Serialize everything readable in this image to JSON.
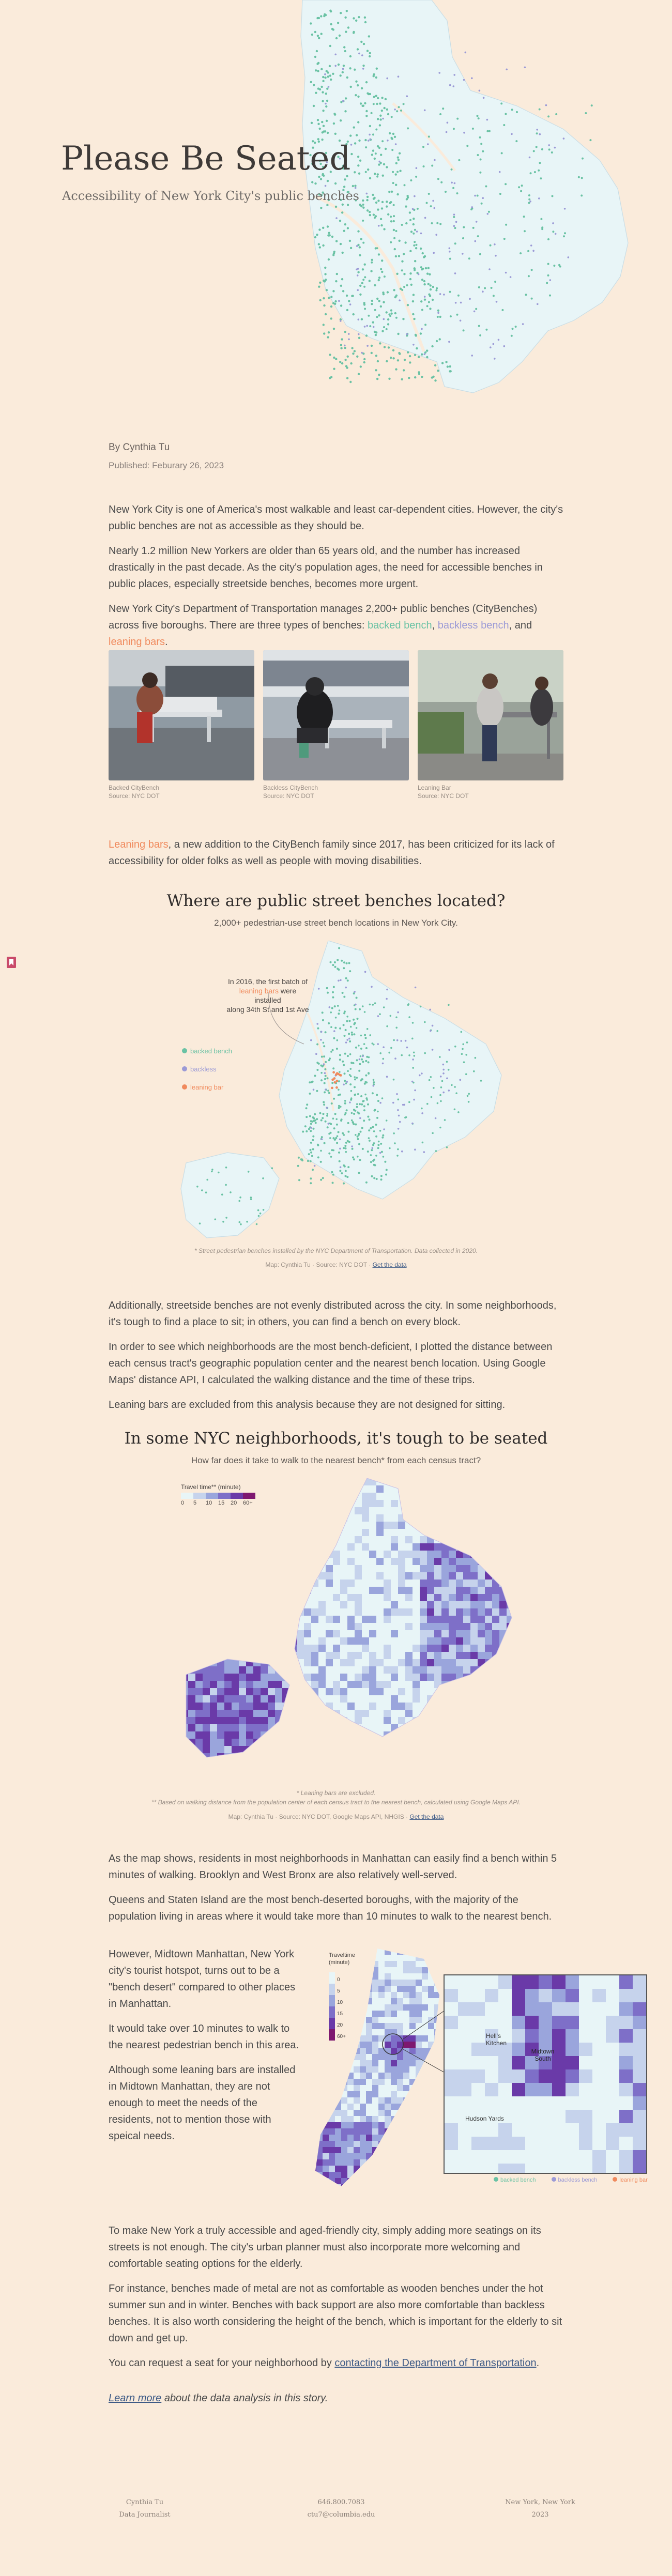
{
  "hero": {
    "title": "Please Be Seated",
    "subtitle": "Accessibility of New York City's public benches"
  },
  "byline": {
    "author": "By Cynthia Tu",
    "published": "Published: Feburary 26, 2023"
  },
  "intro": {
    "p1": "New York City is one of America's most walkable and least car-dependent cities. However, the city's public benches are not as accessible as they should be.",
    "p2": "Nearly 1.2 million New Yorkers are older than 65 years old, and the number has increased drastically in the past decade. As the city's population ages, the need for accessible benches in public places, especially streetside benches, becomes more urgent.",
    "p3_start": "New York City's Department of Transportation manages 2,200+ public benches (CityBenches) across five boroughs. There are three types of benches: ",
    "backed": "backed bench",
    "sep1": ", ",
    "backless": "backless bench",
    "sep2": ", and ",
    "leaning": "leaning bars",
    "end": "."
  },
  "photos": [
    {
      "caption1": "Backed CityBench",
      "caption2": "Source: NYC DOT"
    },
    {
      "caption1": "Backless CityBench",
      "caption2": "Source: NYC DOT"
    },
    {
      "caption1": "Leaning Bar",
      "caption2": "Source: NYC DOT"
    }
  ],
  "leaning_para": {
    "highlight": "Leaning bars",
    "rest": ", a new addition to the CityBench family since 2017, has been criticized for its lack of accessibility for older folks as well as people with moving disabilities."
  },
  "bookmark_icon": "bookmark-icon",
  "section1": {
    "title": "Where are public street benches located?",
    "subtitle": "2,000+ pedestrian-use street bench locations in New York City.",
    "annotation_a": "In 2016, the first batch of",
    "annotation_b_highlight": "leaning bars",
    "annotation_b_rest": " were installed",
    "annotation_c": "along 34th St and 1st Ave",
    "legend": [
      "backed bench",
      "backless",
      "leaning bar"
    ],
    "note": "* Street pedestrian benches installed by the NYC Department of Transportation. Data collected in 2020.",
    "credit": "Map: Cynthia Tu · Source: NYC DOT · ",
    "credit_link": "Get the data"
  },
  "section1_text": {
    "p1": "Additionally, streetside benches are not evenly distributed across the city. In some neighborhoods, it's tough to find a place to sit; in others, you can find a bench on every block.",
    "p2": "In order to see which neighborhoods are the most bench-deficient, I plotted the distance between each census tract's geographic population center and the nearest bench location. Using Google Maps' distance API, I calculated the walking distance and the time of these trips.",
    "p3": "Leaning bars are excluded from this analysis because they are not designed for sitting."
  },
  "section2": {
    "title": "In some NYC neighborhoods, it's tough to be seated",
    "subtitle": "How far does it take to walk to the nearest bench* from each census tract?",
    "legend_title": "Travel time** (minute)",
    "legend_ticks": [
      "0",
      "5",
      "10",
      "15",
      "20",
      "60+"
    ],
    "note1": "* Leaning bars are excluded.",
    "note2": "** Based on walking distance from the population center of each census tract to the nearest bench, calculated using Google Maps API.",
    "credit": "Map: Cynthia Tu · Source: NYC DOT, Google Maps API, NHGIS · ",
    "credit_link": "Get the data"
  },
  "section2_text": {
    "p1": "As the map shows, residents in most neighborhoods in Manhattan can easily find a bench within 5 minutes of walking. Brooklyn and West Bronx are also relatively well-served.",
    "p2": "Queens and Staten Island are the most bench-deserted boroughs, with the majority of the population living in areas where it would take more than 10 minutes to walk to the nearest bench."
  },
  "midtown": {
    "p1": "However, Midtown Manhattan, New York city's tourist hotspot, turns out to be a \"bench desert\" compared to other places in Manhattan.",
    "p2": "It would take over 10 minutes to walk to the nearest pedestrian bench in this area.",
    "p3": "Although some leaning bars are installed in Midtown Manhattan, they are not enough to meet the needs of the residents, not to mention those with speical needs.",
    "legend_title": "Traveltime (minute)",
    "legend_ticks": [
      "0",
      "5",
      "10",
      "15",
      "20",
      "60+"
    ],
    "inset_labels": [
      "Hell's Kitchen",
      "Midtown South",
      "Hudson Yards"
    ],
    "legend": [
      "backed bench",
      "backless bench",
      "leaning bar"
    ]
  },
  "closing": {
    "p1": "To make New York a truly accessible and aged-friendly city, simply adding more seatings on its streets is not enough. The city's urban planner must also incorporate more welcoming and comfortable seating options for the elderly.",
    "p2": "For instance, benches made of metal are not as comfortable as wooden benches under the hot summer sun and in winter. Benches with back support are also more comfortable than backless benches. It is also worth considering the height of the bench, which is important for the elderly to sit down and get up.",
    "p3_start": "You can request a seat for your neighborhood by ",
    "p3_link": "contacting the Department of Transportation",
    "p3_end": ".",
    "learn_link": "Learn more",
    "learn_rest": " about the data analysis in this story."
  },
  "footer": {
    "name": "Cynthia Tu",
    "role": "Data Journalist",
    "phone": "646.800.7083",
    "email": "ctu7@columbia.edu",
    "city": "New York, New York",
    "year": "2023"
  },
  "colors": {
    "background": "#faebdb",
    "backed": "#6ac2a4",
    "backless": "#9b9ad6",
    "leaning": "#f08a5d",
    "ramp": [
      "#e8f5f7",
      "#c6d3ec",
      "#9aa5dc",
      "#7e6fc8",
      "#6a3aa8",
      "#7e1870"
    ]
  }
}
